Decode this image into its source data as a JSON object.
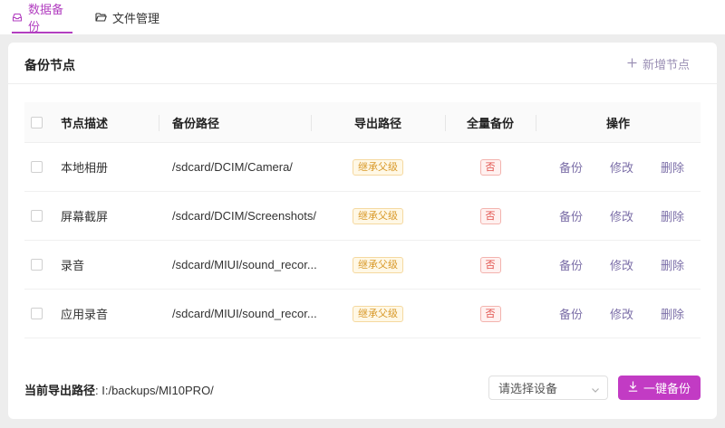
{
  "tabs": [
    {
      "label": "数据备份",
      "icon": "inbox-icon"
    },
    {
      "label": "文件管理",
      "icon": "folder-open-icon"
    }
  ],
  "card": {
    "title": "备份节点",
    "add_label": "新增节点"
  },
  "table": {
    "headers": {
      "desc": "节点描述",
      "path": "备份路径",
      "export": "导出路径",
      "full": "全量备份",
      "actions": "操作"
    },
    "rows": [
      {
        "desc": "本地相册",
        "path": "/sdcard/DCIM/Camera/",
        "export": "继承父级",
        "full": "否",
        "backup": "备份",
        "edit": "修改",
        "delete": "删除"
      },
      {
        "desc": "屏幕截屏",
        "path": "/sdcard/DCIM/Screenshots/",
        "export": "继承父级",
        "full": "否",
        "backup": "备份",
        "edit": "修改",
        "delete": "删除"
      },
      {
        "desc": "录音",
        "path": "/sdcard/MIUI/sound_recor...",
        "export": "继承父级",
        "full": "否",
        "backup": "备份",
        "edit": "修改",
        "delete": "删除"
      },
      {
        "desc": "应用录音",
        "path": "/sdcard/MIUI/sound_recor...",
        "export": "继承父级",
        "full": "否",
        "backup": "备份",
        "edit": "修改",
        "delete": "删除"
      }
    ]
  },
  "footer": {
    "path_label": "当前导出路径",
    "path_value": ": I:/backups/MI10PRO/",
    "device_placeholder": "请选择设备",
    "backup_button": "一键备份"
  },
  "colors": {
    "accent": "#c23bc4",
    "tab_active": "#b23fc0",
    "action_link": "#7c6fa8"
  }
}
